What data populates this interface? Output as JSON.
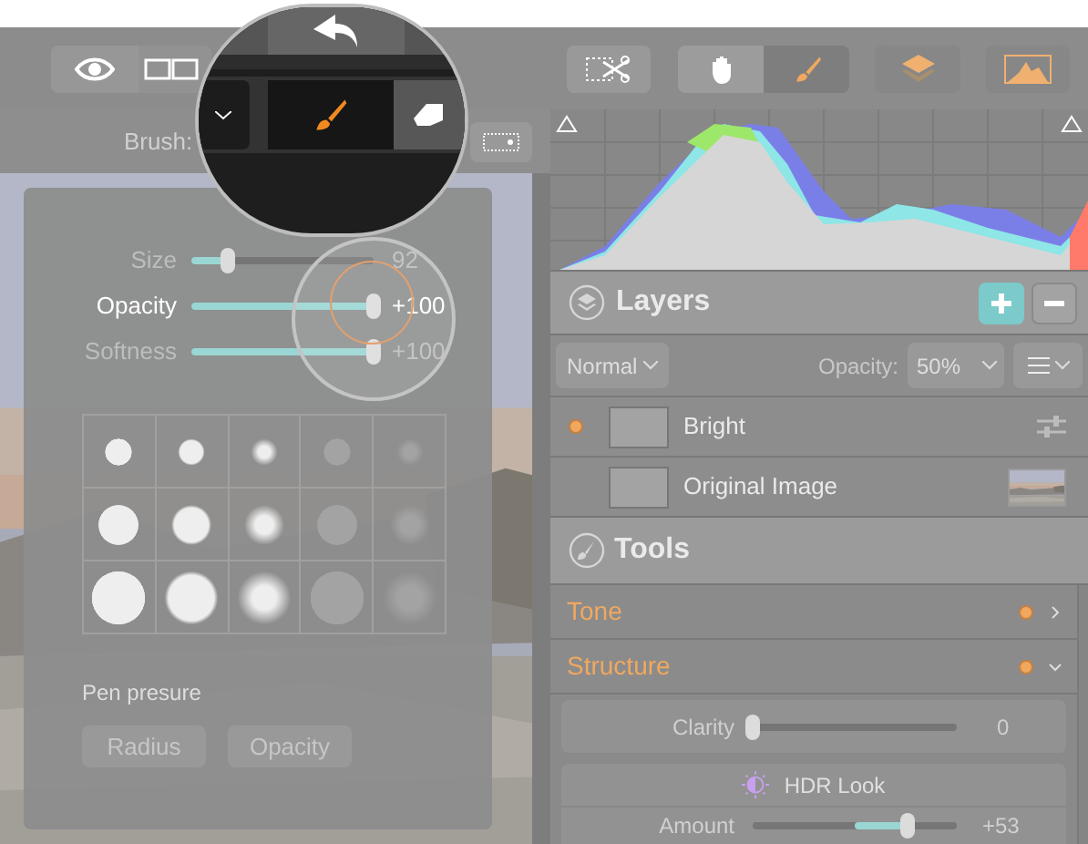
{
  "toolbar": {
    "tools": [
      {
        "kind": "hand",
        "selected": false
      },
      {
        "kind": "brush",
        "selected": true
      }
    ]
  },
  "brush_bar": {
    "label": "Brush:"
  },
  "magnifier": {
    "brush_modes": [
      {
        "kind": "brush",
        "selected": true
      },
      {
        "kind": "eraser",
        "selected": false
      }
    ]
  },
  "brush_panel": {
    "sliders": [
      {
        "label": "Size",
        "level": 0.2,
        "reading": "92",
        "active": false
      },
      {
        "label": "Opacity",
        "level": 1,
        "reading": "+100",
        "active": true
      },
      {
        "label": "Softness",
        "level": 1,
        "reading": "+100",
        "active": false
      }
    ],
    "pen_pressure": {
      "label": "Pen presure",
      "buttons": [
        "Radius",
        "Opacity"
      ]
    }
  },
  "layers": {
    "title": "Layers",
    "blend_mode": "Normal",
    "opacity_label": "Opacity:",
    "opacity": "50%",
    "items": [
      {
        "name": "Bright",
        "active": true,
        "kind": "adjustment"
      },
      {
        "name": "Original Image",
        "active": false
      }
    ]
  },
  "tools": {
    "title": "Tools",
    "sections": [
      {
        "name": "Tone",
        "expanded": false
      },
      {
        "name": "Structure",
        "expanded": true
      }
    ],
    "clarity": {
      "label": "Clarity",
      "level": 0,
      "reading": "0"
    },
    "hdr": {
      "title": "HDR Look",
      "amount": {
        "label": "Amount",
        "level": 0.76,
        "reading": "+53"
      }
    }
  }
}
